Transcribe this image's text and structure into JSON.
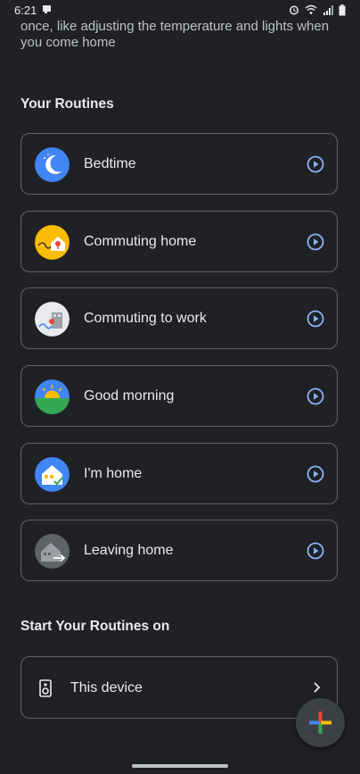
{
  "status": {
    "time": "6:21"
  },
  "intro_text": "once, like adjusting the temperature and lights when you come home",
  "routines_section": {
    "title": "Your Routines",
    "items": [
      {
        "label": "Bedtime"
      },
      {
        "label": "Commuting home"
      },
      {
        "label": "Commuting to work"
      },
      {
        "label": "Good morning"
      },
      {
        "label": "I'm home"
      },
      {
        "label": "Leaving home"
      }
    ]
  },
  "start_section": {
    "title": "Start Your Routines on",
    "device_label": "This device"
  },
  "colors": {
    "background": "#202124",
    "card_border": "#5f6368",
    "accent_blue": "#8ab4f8"
  }
}
